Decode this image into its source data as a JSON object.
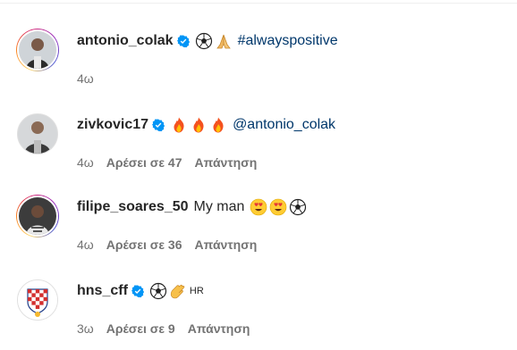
{
  "comments": [
    {
      "username": "antonio_colak",
      "verified": true,
      "text": "",
      "emojis": [
        "soccer-ball",
        "folded-hands"
      ],
      "hashtag": "#alwayspositive",
      "mention": "",
      "time": "4ω",
      "likes": "",
      "reply": ""
    },
    {
      "username": "zivkovic17",
      "verified": true,
      "text": "",
      "emojis": [
        "fire",
        "fire",
        "fire"
      ],
      "hashtag": "",
      "mention": "@antonio_colak",
      "time": "4ω",
      "likes": "Αρέσει σε 47",
      "reply": "Απάντηση"
    },
    {
      "username": "filipe_soares_50",
      "verified": false,
      "text": "My man",
      "emojis": [
        "heart-eyes",
        "heart-eyes",
        "soccer-ball"
      ],
      "hashtag": "",
      "mention": "",
      "time": "4ω",
      "likes": "Αρέσει σε 36",
      "reply": "Απάντηση"
    },
    {
      "username": "hns_cff",
      "verified": true,
      "text": "",
      "emojis": [
        "soccer-ball",
        "clapping-hands"
      ],
      "flag_text": "HR",
      "hashtag": "",
      "mention": "",
      "time": "3ω",
      "likes": "Αρέσει σε 9",
      "reply": "Απάντηση"
    }
  ],
  "colors": {
    "verified": "#0095f6",
    "link": "#00376b",
    "meta": "#737373"
  }
}
